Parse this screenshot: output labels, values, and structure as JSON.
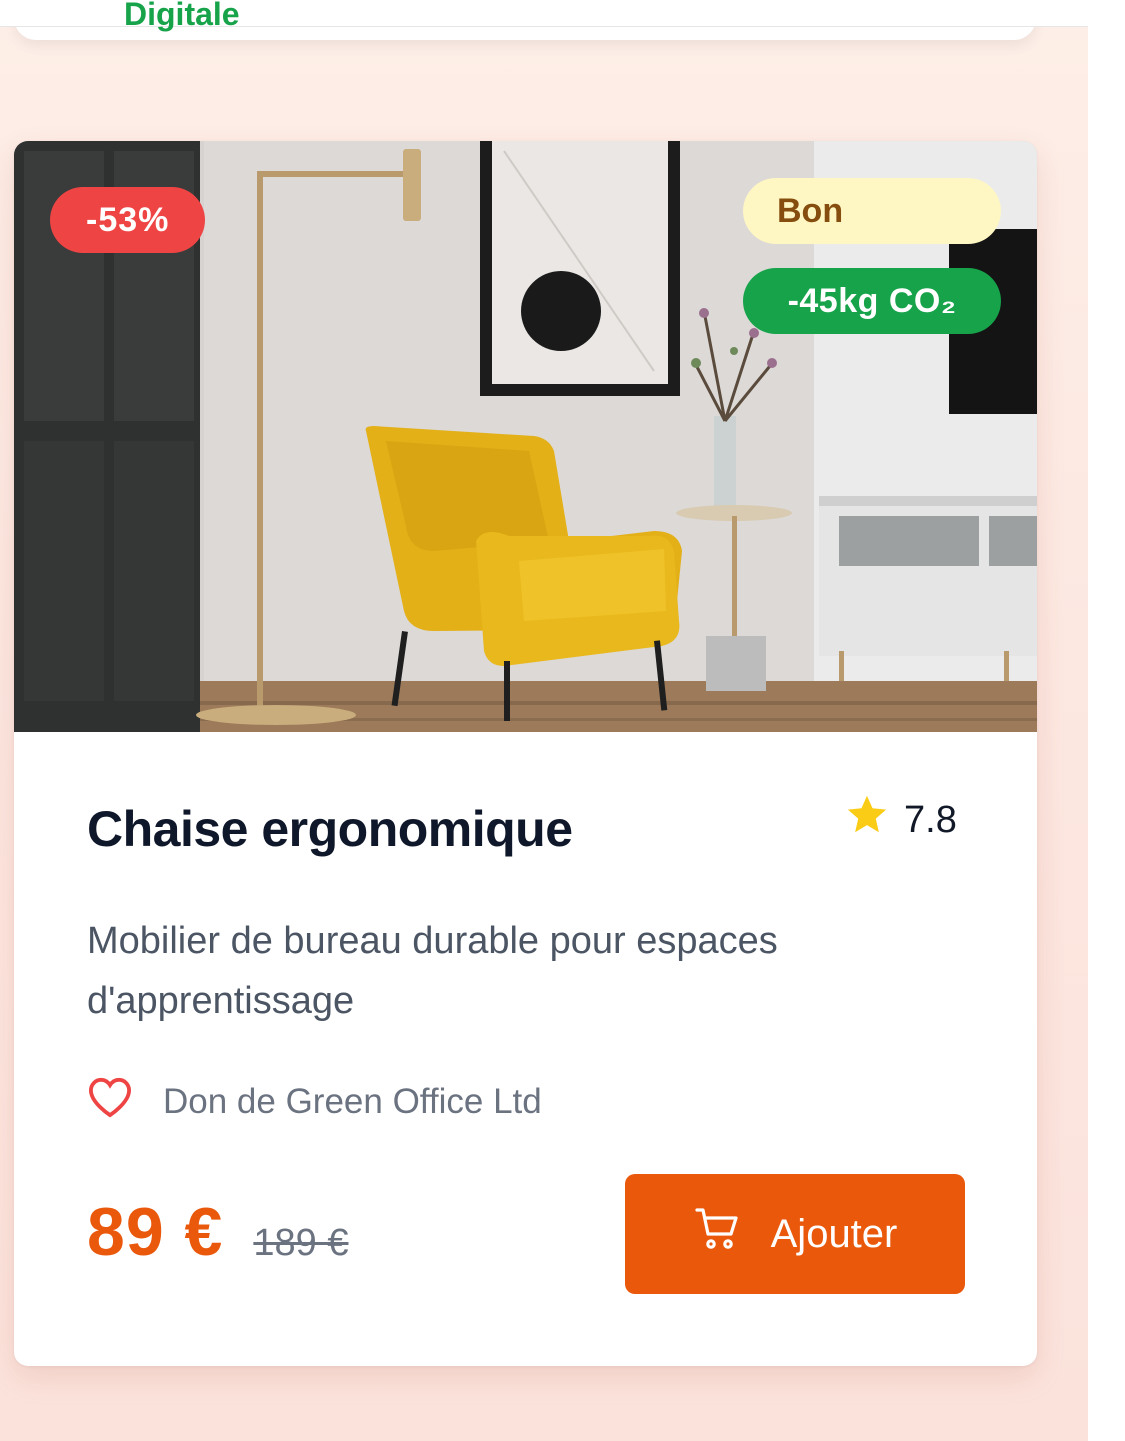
{
  "previous_card": {
    "label": "Digitale"
  },
  "product": {
    "discount_badge": "-53%",
    "condition_badge": "Bon",
    "co2_badge": "-45kg CO₂",
    "title": "Chaise ergonomique",
    "rating": "7.8",
    "description": "Mobilier de bureau durable pour espaces d'apprentissage",
    "donor": "Don de Green Office Ltd",
    "price": "89 €",
    "old_price": "189 €",
    "add_button_label": "Ajouter"
  },
  "icons": {
    "rating": "star-icon",
    "donor": "heart-icon",
    "add_button": "cart-icon"
  },
  "colors": {
    "accent": "#ea580c",
    "discount": "#ef4444",
    "condition_bg": "#fef6c3",
    "condition_text": "#854d0e",
    "co2": "#16a34a",
    "star": "#facc15",
    "heart": "#ef4444"
  }
}
